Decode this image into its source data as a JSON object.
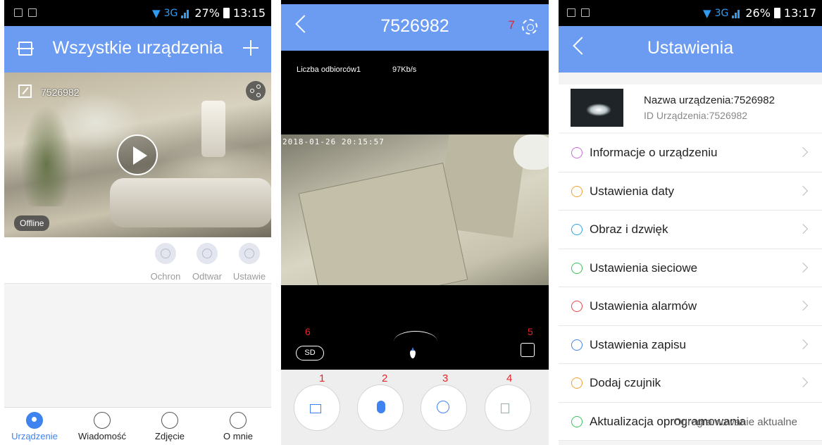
{
  "screen1": {
    "status": {
      "network": "3G",
      "battery": "27%",
      "time": "13:15"
    },
    "header": {
      "title": "Wszystkie urządzenia"
    },
    "device": {
      "name": "7526982",
      "status_badge": "Offline"
    },
    "actions": [
      {
        "label": "Ochron",
        "icon": "shield-icon"
      },
      {
        "label": "Odtwar",
        "icon": "playback-icon"
      },
      {
        "label": "Ustawie",
        "icon": "gear-icon"
      }
    ],
    "tabs": [
      {
        "label": "Urządzenie",
        "icon": "location-pin-icon",
        "active": true
      },
      {
        "label": "Wiadomość",
        "icon": "chat-bubble-icon"
      },
      {
        "label": "Zdjęcie",
        "icon": "picture-icon"
      },
      {
        "label": "O mnie",
        "icon": "person-icon"
      }
    ]
  },
  "screen2": {
    "header": {
      "title": "7526982"
    },
    "viewers": "Liczba odbiorców1",
    "bitrate": "97Kb/s",
    "osd_time": "2018-01-26  20:15:57",
    "quality": "SD",
    "labels": {
      "settings": "7",
      "quality": "6",
      "fullscreen": "5",
      "record": "1",
      "mic": "2",
      "snapshot": "3",
      "mute": "4"
    },
    "accent": "#3f83f0"
  },
  "screen3": {
    "status": {
      "network": "3G",
      "battery": "26%",
      "time": "13:17"
    },
    "header": {
      "title": "Ustawienia"
    },
    "device": {
      "name": "Nazwa urządzenia:7526982",
      "id": "ID Urządzenia:7526982"
    },
    "menu": [
      {
        "label": "Informacje o urządzeniu",
        "color": "#c86bd8"
      },
      {
        "label": "Ustawienia daty",
        "color": "#f0a030"
      },
      {
        "label": "Obraz i dzwięk",
        "color": "#2aa4e8"
      },
      {
        "label": "Ustawienia sieciowe",
        "color": "#38c25a"
      },
      {
        "label": "Ustawienia alarmów",
        "color": "#e84545"
      },
      {
        "label": "Ustawienia zapisu",
        "color": "#3f83f0"
      },
      {
        "label": "Dodaj czujnik",
        "color": "#f0a030"
      }
    ],
    "update": {
      "label": "Aktualizacja oprogramowania",
      "value": "Oprogramowanie aktualne",
      "color": "#38c25a"
    }
  }
}
